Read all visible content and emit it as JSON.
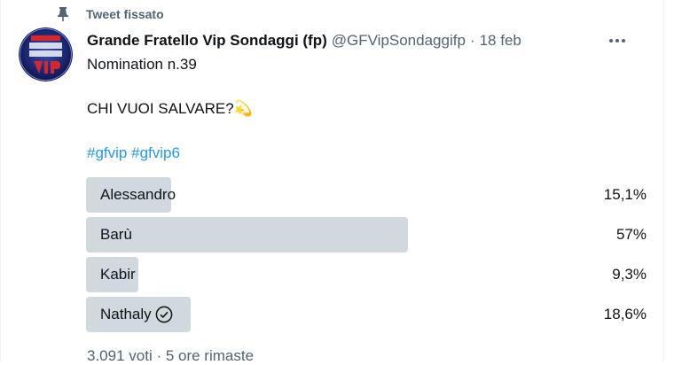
{
  "pinned": {
    "label": "Tweet fissato",
    "icon": "pin-icon"
  },
  "author": {
    "display_name": "Grande Fratello Vip Sondaggi (fp)",
    "handle": "@GFVipSondaggifp",
    "separator": "·",
    "date": "18 feb",
    "avatar_icon": "gf-vip-logo-avatar",
    "avatar_logo_text": "GRANDE FRATELLO VIP"
  },
  "tweet": {
    "line1": "Nomination n.39",
    "line2": "CHI VUOI SALVARE?",
    "line2_emoji": "💫",
    "hashtags": [
      "#gfvip",
      "#gfvip6"
    ]
  },
  "poll": {
    "options": [
      {
        "label": "Alessandro",
        "percent_text": "15,1%",
        "percent": 15.1,
        "winner": false
      },
      {
        "label": "Barù",
        "percent_text": "57%",
        "percent": 57,
        "winner": false
      },
      {
        "label": "Kabir",
        "percent_text": "9,3%",
        "percent": 9.3,
        "winner": false
      },
      {
        "label": "Nathaly",
        "percent_text": "18,6%",
        "percent": 18.6,
        "winner": true
      }
    ],
    "footer": "3.091 voti · 5 ore rimaste"
  },
  "colors": {
    "bar": "#cfd9de",
    "link": "#1d9bf0",
    "secondary_text": "#536471",
    "primary_text": "#0f1419"
  }
}
